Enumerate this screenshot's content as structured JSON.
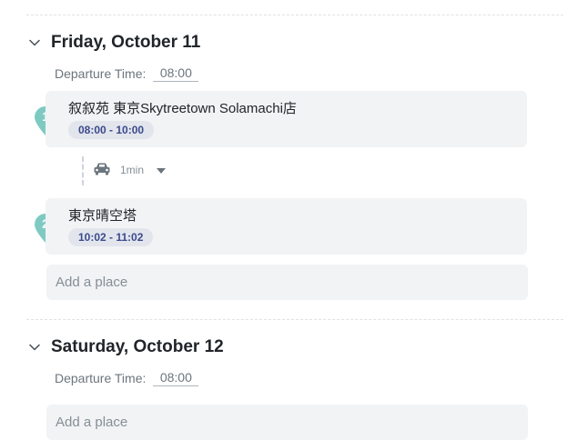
{
  "days": [
    {
      "title": "Friday, October 11",
      "departure_label": "Departure Time:",
      "departure_value": "08:00",
      "places": [
        {
          "number": "1",
          "name": "叙叙苑 東京Skytreetown Solamachi店",
          "time": "08:00 - 10:00"
        },
        {
          "number": "2",
          "name": "東京晴空塔",
          "time": "10:02 - 11:02"
        }
      ],
      "transit": {
        "mode_icon": "car-icon",
        "duration": "1min"
      },
      "add_place_placeholder": "Add a place"
    },
    {
      "title": "Saturday, October 12",
      "departure_label": "Departure Time:",
      "departure_value": "08:00",
      "add_place_placeholder": "Add a place"
    }
  ],
  "colors": {
    "pin": "#7ecac3",
    "badge_bg": "#e2e5ec",
    "badge_text": "#3b4a8c",
    "card_bg": "#f1f3f5"
  }
}
